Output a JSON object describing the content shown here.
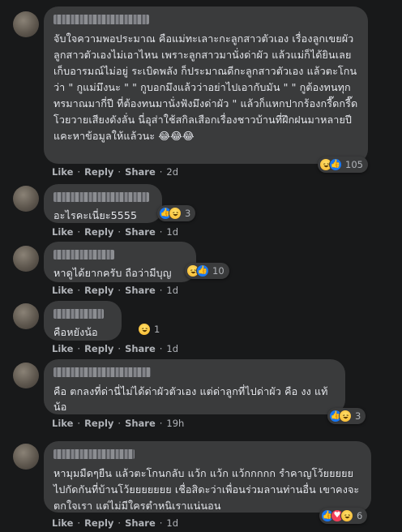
{
  "comments": [
    {
      "text": "จับใจความพอประมาณ คือแม่ทะเลาะกะลูกสาวตัวเอง เรื่องลูกเขยผัวลูกสาวตัวเองไม่เอาไหน เพราะลูกสาวมานั่งด่าผัว แล้วแม่ก็ได้ยินเลยเก็บอารมณ์ไม่อยู่ ระเบิดพลัง ก็ประมาณดีกะลูกสาวตัวเอง แล้วตะโกนว่า \" กูแม่มึงนะ \" \" กูบอกมึงแล้วว่าอย่าไปเอากับมัน \" \" กูต้องทนทุกทรมาณมากี่ปี ที่ต้องทนมานั่งฟังมึงด่าผัว \" แล้วก็แหกปากร้องกรี๊ดกรี๊ด โวยวายเสียงดังลั่น นี่อุส่าใช้สกิลเสือกเรื่องชาวบ้านที่ฝึกฝนมาหลายปี แคะหาข้อมูลให้แล้วนะ 😂😂😂",
      "reaction_count": "105",
      "like": "Like",
      "reply": "Reply",
      "share": "Share",
      "time": "2d"
    },
    {
      "text": "อะไรคะเนี่ยะ5555",
      "reaction_count": "3",
      "like": "Like",
      "reply": "Reply",
      "share": "Share",
      "time": "1d"
    },
    {
      "text": "หาดูได้ยากครับ ถือว่ามีบุญ",
      "reaction_count": "10",
      "like": "Like",
      "reply": "Reply",
      "share": "Share",
      "time": "1d"
    },
    {
      "text": "คือหยังน้อ",
      "reaction_count": "1",
      "like": "Like",
      "reply": "Reply",
      "share": "Share",
      "time": "1d"
    },
    {
      "text": "คือ ตกลงที่ด่านี่ไม่ได้ด่าผัวตัวเอง แต่ด่าลูกที่ไปด่าผัว คือ งง แท้น้อ",
      "reaction_count": "3",
      "like": "Like",
      "reply": "Reply",
      "share": "Share",
      "time": "19h"
    },
    {
      "text": "หามุมมืดๆยืน แล้วตะโกนกลับ แว้ก แว้ก แว้กกกกก รำคาญโว้ยยยยย ไปกัดกันที่บ้านโว้ยยยยยยย เชื่อสิดะว่าเพื่อนร่วมลานท่านอื่น เขาคงจะตกใจเรา แต่ไม่มีใครตำหนิเราแน่นอน",
      "reaction_count": "6",
      "like": "Like",
      "reply": "Reply",
      "share": "Share",
      "time": "1d"
    }
  ],
  "colors": {
    "background": "#18191a",
    "bubble": "#3a3b3c",
    "text": "#e4e6eb",
    "secondary_text": "#b0b3b8",
    "like_blue": "#1877f2",
    "love_red": "#f33e58",
    "haha_yellow": "#f7b125"
  },
  "icons": {
    "haha": "haha-reaction-icon",
    "like": "like-reaction-icon",
    "love": "love-reaction-icon"
  }
}
